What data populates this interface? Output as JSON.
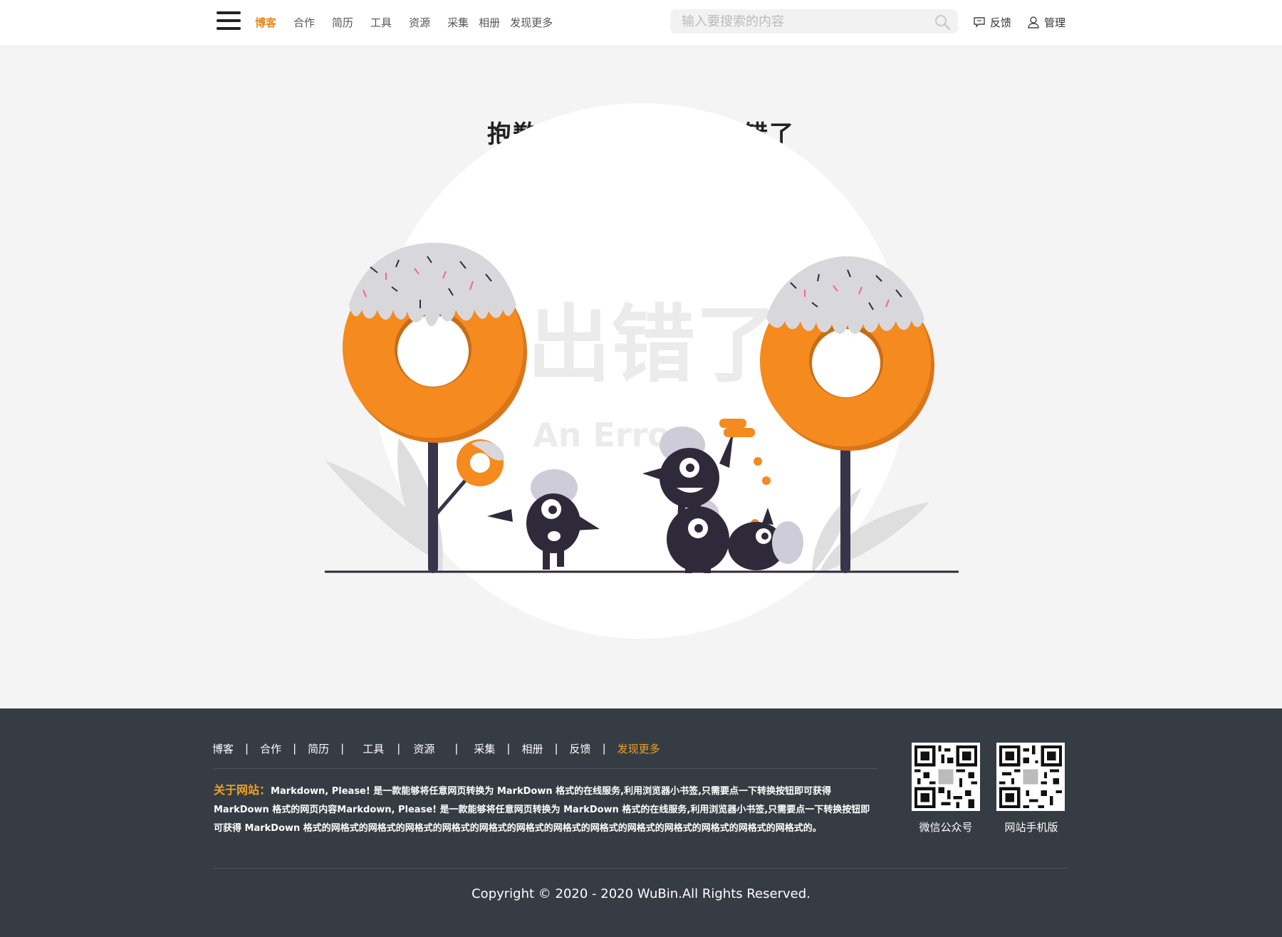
{
  "header": {
    "nav": [
      "博客",
      "合作",
      "简历",
      "工具",
      "资源",
      "采集",
      "相册",
      "发现更多"
    ],
    "active_nav": "博客",
    "search_placeholder": "输入要搜索的内容",
    "feedback_label": "反馈",
    "admin_label": "管理"
  },
  "main": {
    "error_title": "抱歉，您访问的页面出错了",
    "illustration_big_text": "出错了",
    "illustration_sub_text": "An Error"
  },
  "footer": {
    "nav": [
      "博客",
      "合作",
      "简历",
      "工具",
      "资源",
      "采集",
      "相册",
      "反馈",
      "发现更多"
    ],
    "about_label": "关于网站：",
    "about_text": "Markdown, Please! 是一款能够将任意网页转换为 MarkDown 格式的在线服务,利用浏览器小书签,只需要点一下转换按钮即可获得 MarkDown 格式的网页内容Markdown, Please! 是一款能够将任意网页转换为 MarkDown 格式的在线服务,利用浏览器小书签,只需要点一下转换按钮即可获得 MarkDown 格式的网格式的网格式的网格式的网格式的网格式的网格式的网格式的网格式的网格式的网格式的网格式的网格式的网格式的。",
    "qr_wechat_label": "微信公众号",
    "qr_mobile_label": "网站手机版",
    "copyright": "Copyright © 2020 - 2020 WuBin.All Rights Reserved."
  },
  "colors": {
    "accent": "#e8871e",
    "footer_bg": "#353c44",
    "donut": "#f58a1f",
    "icing": "#d8d8dc",
    "monster": "#2e2a3a"
  }
}
